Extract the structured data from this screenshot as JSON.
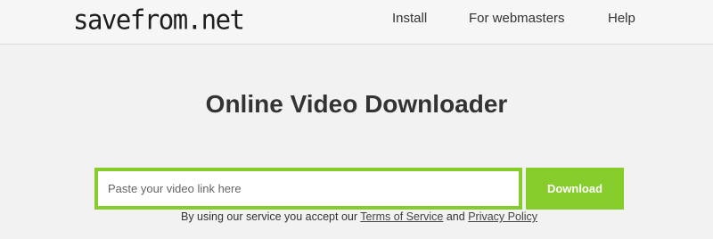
{
  "header": {
    "logo": "savefrom.net",
    "nav": {
      "install": "Install",
      "webmasters": "For webmasters",
      "help": "Help"
    }
  },
  "main": {
    "title": "Online Video Downloader",
    "search": {
      "placeholder": "Paste your video link here",
      "value": ""
    },
    "download_label": "Download",
    "terms": {
      "prefix": "By using our service you accept our",
      "terms_link": "Terms of Service",
      "conjunction": "and",
      "privacy_link": "Privacy Policy"
    }
  },
  "colors": {
    "accent": "#86cc2a",
    "background": "#f2f2f2",
    "text": "#333333"
  }
}
